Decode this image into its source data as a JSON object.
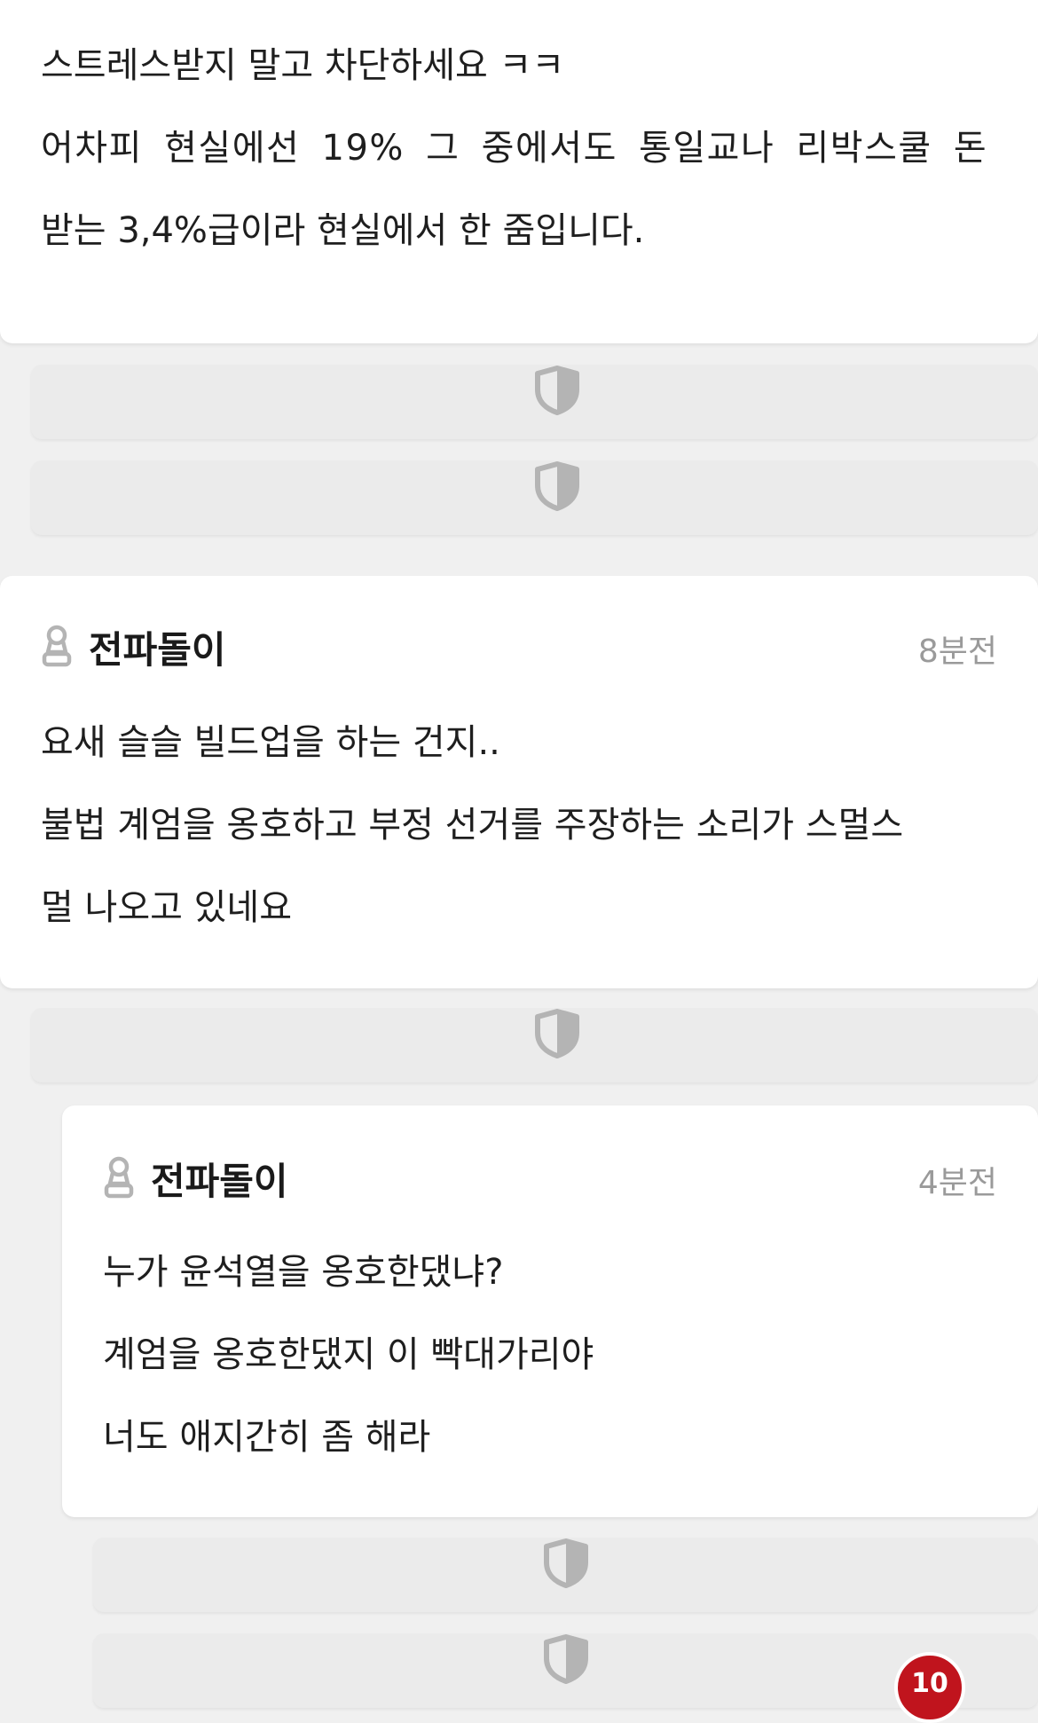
{
  "comment_top": {
    "lines": [
      "스트레스받지 말고 차단하세요 ㅋㅋ",
      "어차피 현실에선 19% 그 중에서도 통일교나 리박스쿨 돈",
      "받는 3,4%급이라 현실에서 한 줌입니다."
    ]
  },
  "comment_2": {
    "author": "전파돌이",
    "time": "8분전",
    "lines": [
      "요새 슬슬 빌드업을 하는 건지..",
      "불법 계엄을 옹호하고 부정 선거를 주장하는 소리가 스멀스",
      "멀 나오고 있네요"
    ]
  },
  "reply_3": {
    "author": "전파돌이",
    "time": "4분전",
    "lines": [
      "누가 윤석열을 옹호한댔냐?",
      "계엄을 옹호한댔지 이 빡대가리야",
      "너도 애지간히 좀 해라"
    ]
  },
  "badge": {
    "count": "10"
  },
  "icons": {
    "collapsed": "shield-icon",
    "user": "user-level-icon"
  },
  "colors": {
    "background": "#f0f0f0",
    "card": "#ffffff",
    "collapsed": "#ebebeb",
    "icon": "#b4b4b4",
    "timestamp": "#9a9a9a",
    "badge": "#c0141d"
  }
}
